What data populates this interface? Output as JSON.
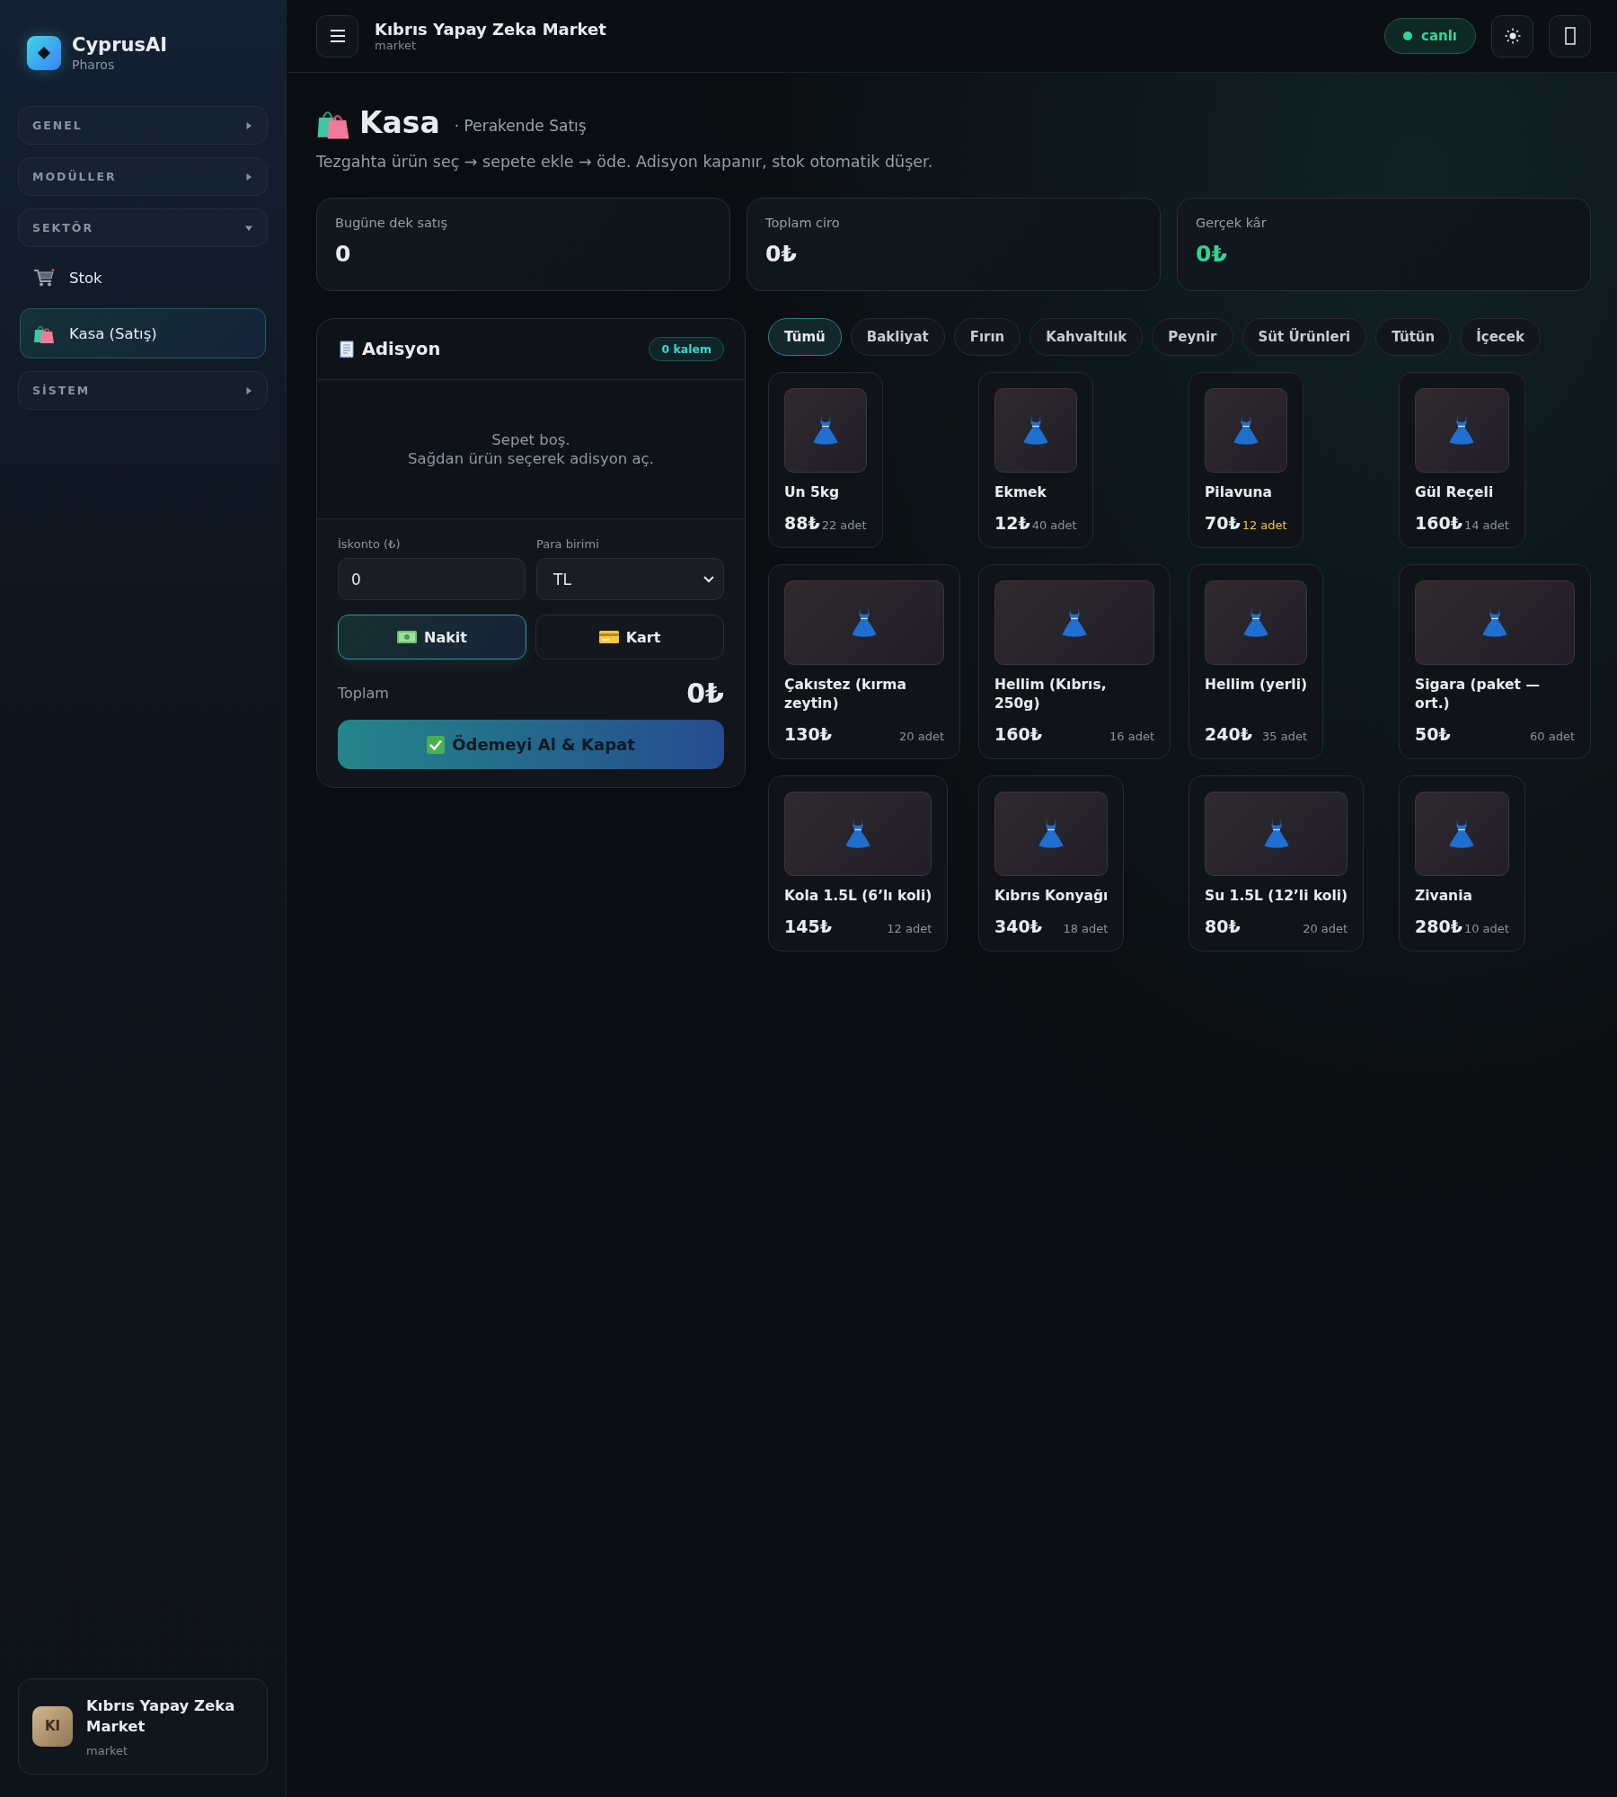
{
  "brand": {
    "name": "CyprusAI",
    "subtitle": "Pharos"
  },
  "sidebar": {
    "items": [
      {
        "kind": "group",
        "label": "GENEL",
        "expanded": false
      },
      {
        "kind": "group",
        "label": "MODÜLLER",
        "expanded": false
      },
      {
        "kind": "group",
        "label": "SEKTÖR",
        "expanded": true
      },
      {
        "kind": "link",
        "label": "Stok",
        "selected": false
      },
      {
        "kind": "link",
        "label": "Kasa (Satış)",
        "selected": true
      },
      {
        "kind": "group",
        "label": "SİSTEM",
        "expanded": false
      }
    ],
    "account": {
      "initials": "KI",
      "name": "Kıbrıs Yapay Zeka Market",
      "role": "market"
    }
  },
  "header": {
    "title": "Kıbrıs Yapay Zeka Market",
    "subtitle": "market",
    "status": "canlı"
  },
  "page": {
    "title": "Kasa",
    "subtitle": "· Perakende Satış",
    "description": "Tezgahta ürün seç → sepete ekle → öde. Adisyon kapanır, stok otomatik düşer."
  },
  "stats": [
    {
      "label": "Bugüne dek satış",
      "value": "0",
      "highlight": false
    },
    {
      "label": "Toplam ciro",
      "value": "0₺",
      "highlight": false
    },
    {
      "label": "Gerçek kâr",
      "value": "0₺",
      "highlight": true
    }
  ],
  "receipt": {
    "title": "Adisyon",
    "badge": "0 kalem",
    "empty_lines": [
      "Sepet boş.",
      "Sağdan ürün seçerek adisyon aç."
    ],
    "discount": {
      "label": "İskonto (₺)",
      "value": "0"
    },
    "currency": {
      "label": "Para birimi",
      "value": "TL"
    },
    "payment_methods": [
      {
        "label": "Nakit",
        "selected": true
      },
      {
        "label": "Kart",
        "selected": false
      }
    ],
    "total_label": "Toplam",
    "total": "0₺",
    "pay_button": "Ödemeyi Al & Kapat"
  },
  "categories": [
    {
      "label": "Tümü",
      "selected": true
    },
    {
      "label": "Bakliyat",
      "selected": false
    },
    {
      "label": "Fırın",
      "selected": false
    },
    {
      "label": "Kahvaltılık",
      "selected": false
    },
    {
      "label": "Peynir",
      "selected": false
    },
    {
      "label": "Süt Ürünleri",
      "selected": false
    },
    {
      "label": "Tütün",
      "selected": false
    },
    {
      "label": "İçecek",
      "selected": false
    }
  ],
  "products": [
    {
      "name": "Un 5kg",
      "price": "88₺",
      "stock": "22 adet",
      "low": false
    },
    {
      "name": "Ekmek",
      "price": "12₺",
      "stock": "40 adet",
      "low": false
    },
    {
      "name": "Pilavuna",
      "price": "70₺",
      "stock": "12 adet",
      "low": true
    },
    {
      "name": "Gül Reçeli",
      "price": "160₺",
      "stock": "14 adet",
      "low": false
    },
    {
      "name": "Çakıstez (kırma zeytin)",
      "price": "130₺",
      "stock": "20 adet",
      "low": false
    },
    {
      "name": "Hellim (Kıbrıs, 250g)",
      "price": "160₺",
      "stock": "16 adet",
      "low": false
    },
    {
      "name": "Hellim (yerli)",
      "price": "240₺",
      "stock": "35 adet",
      "low": false
    },
    {
      "name": "Sigara (paket — ort.)",
      "price": "50₺",
      "stock": "60 adet",
      "low": false
    },
    {
      "name": "Kola 1.5L (6’lı koli)",
      "price": "145₺",
      "stock": "12 adet",
      "low": false
    },
    {
      "name": "Kıbrıs Konyağı",
      "price": "340₺",
      "stock": "18 adet",
      "low": false
    },
    {
      "name": "Su 1.5L (12’li koli)",
      "price": "80₺",
      "stock": "20 adet",
      "low": false
    },
    {
      "name": "Zivania",
      "price": "280₺",
      "stock": "10 adet",
      "low": false
    }
  ]
}
